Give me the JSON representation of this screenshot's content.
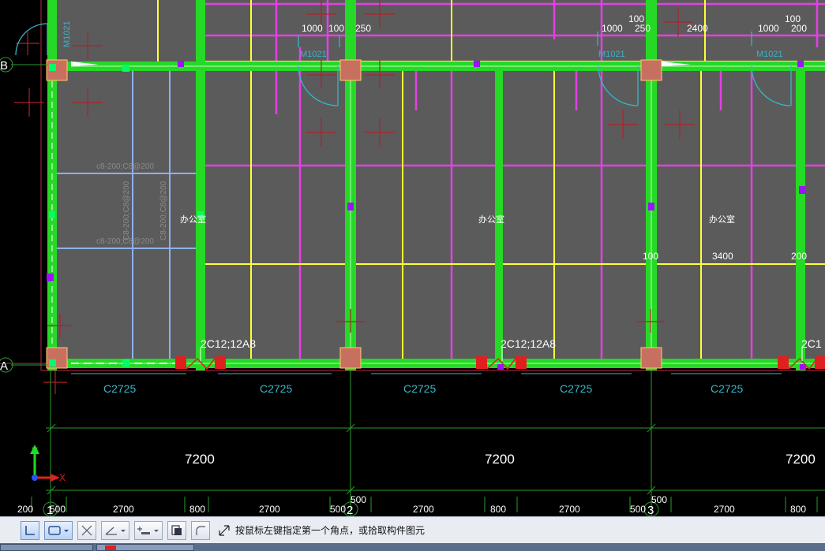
{
  "grid_axes": {
    "b": "B",
    "a": "A",
    "n1": "1",
    "n2": "2",
    "n3": "3"
  },
  "door_dims": {
    "d1": "1000",
    "d2": "100",
    "d3": "250",
    "d4": "100",
    "d5": "1000",
    "d6": "250",
    "d7": "2400",
    "d8": "100",
    "d9": "1000",
    "d10": "200"
  },
  "door_tags": {
    "t1": "M1021",
    "t2": "M1021",
    "t3": "M1021"
  },
  "slab_rebar": {
    "top": "c8-200;C8@200",
    "bottom": "c8-200;C8@200",
    "vert_left": "C8-200;C8@200",
    "vert_right": "C8-200;C8@200"
  },
  "room_labels": {
    "r1": "办公室",
    "r2": "办公室",
    "r3": "办公室"
  },
  "inner_dims": {
    "a": "100",
    "b": "3400",
    "c": "200"
  },
  "beam_tags": {
    "b1": "2C12;12A8",
    "b2": "2C12;12A8",
    "b3": "2C1"
  },
  "window_tags": {
    "w1": "C2725",
    "w2": "C2725",
    "w3": "C2725",
    "w4": "C2725",
    "w5": "C2725"
  },
  "bay_dims": {
    "d1": "7200",
    "d2": "7200",
    "d3": "7200"
  },
  "detail_dims": {
    "a": "200",
    "b": "500",
    "c": "2700",
    "d": "800",
    "e": "2700",
    "f": "500",
    "g": "500",
    "h": "2700",
    "i": "800",
    "j": "2700",
    "k": "500",
    "l": "500",
    "m": "2700",
    "n": "800"
  },
  "ucs": {
    "x": "X",
    "y": "Y"
  },
  "toolbar": {
    "buttons": [
      "ortho",
      "rect-select",
      "cross",
      "angle",
      "point-add",
      "copy-layer",
      "arc-draw"
    ],
    "prompt": "按鼠标左键指定第一个角点，或拾取构件图元"
  },
  "colors": {
    "wall": "#26d926",
    "beam": "#ffff33",
    "rebar": "#e63ee6",
    "slab_rebar": "#8fb0f0",
    "column": "#c87060",
    "axis": "#2a9b2a",
    "text_cyan": "#35b6c8",
    "room_fill": "#5b5b5b"
  }
}
